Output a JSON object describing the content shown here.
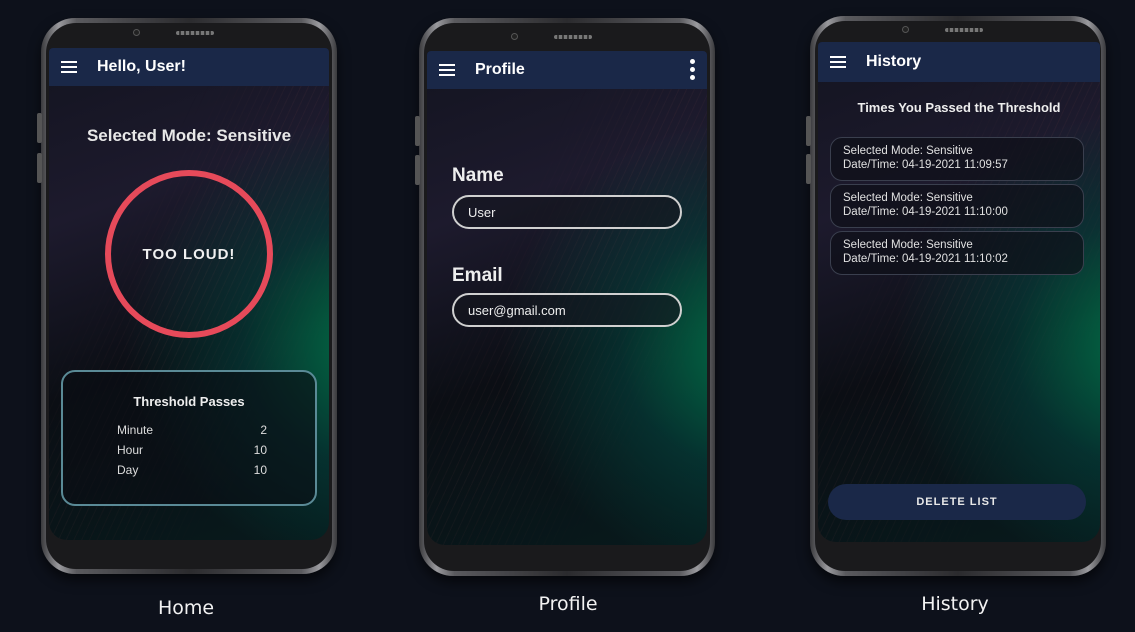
{
  "home": {
    "title": "Hello, User!",
    "mode": "Selected Mode: Sensitive",
    "alert": "TOO LOUD!",
    "stats_title": "Threshold Passes",
    "stats": [
      {
        "label": "Minute",
        "value": "2"
      },
      {
        "label": "Hour",
        "value": "10"
      },
      {
        "label": "Day",
        "value": "10"
      }
    ],
    "caption": "Home"
  },
  "profile": {
    "title": "Profile",
    "name_label": "Name",
    "name_value": "User",
    "email_label": "Email",
    "email_value": "user@gmail.com",
    "caption": "Profile"
  },
  "history": {
    "title": "History",
    "heading": "Times You Passed the Threshold",
    "items": [
      {
        "mode": "Selected Mode: Sensitive",
        "datetime": "Date/Time: 04-19-2021 11:09:57"
      },
      {
        "mode": "Selected Mode: Sensitive",
        "datetime": "Date/Time: 04-19-2021 11:10:00"
      },
      {
        "mode": "Selected Mode: Sensitive",
        "datetime": "Date/Time: 04-19-2021 11:10:02"
      }
    ],
    "delete_label": "DELETE LIST",
    "caption": "History"
  },
  "colors": {
    "background": "#0d111b",
    "appbar": "#1a2848",
    "alert_ring": "#e64a5a",
    "stats_border": "#5a8a96"
  }
}
